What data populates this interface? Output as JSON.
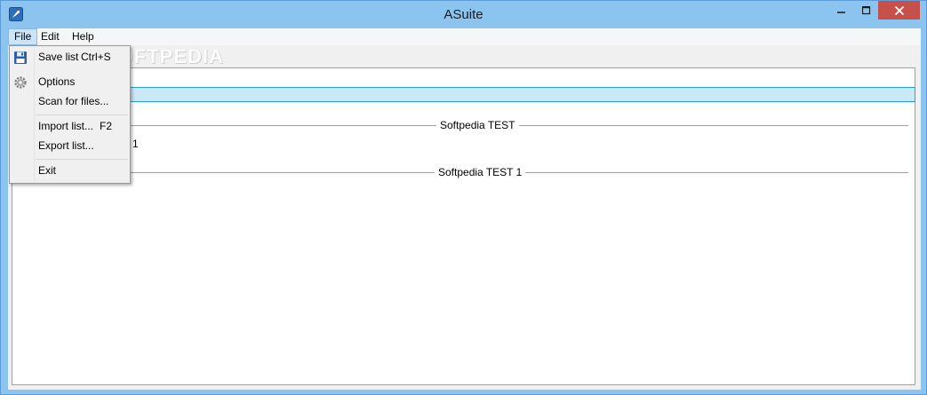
{
  "window": {
    "title": "ASuite"
  },
  "menu": {
    "file": "File",
    "edit": "Edit",
    "help": "Help"
  },
  "watermark": "SOFTPEDIA",
  "file_menu": {
    "save_list": "Save list",
    "save_list_shortcut": "Ctrl+S",
    "options": "Options",
    "scan_for_files": "Scan for files...",
    "import_list": "Import list...",
    "import_list_shortcut": "F2",
    "export_list": "Export list...",
    "exit": "Exit"
  },
  "tree": {
    "separator_1": "Softpedia TEST",
    "child_fragment": "1",
    "separator_2": "Softpedia TEST 1"
  },
  "icons": [
    "rocket-icon",
    "floppy-disk-icon",
    "gear-icon",
    "minimize-icon",
    "maximize-icon",
    "close-icon"
  ],
  "colors": {
    "frame": "#8cc4f0",
    "close": "#c7504b",
    "selection": "#cbe8f6",
    "selection_border": "#26a0da"
  }
}
